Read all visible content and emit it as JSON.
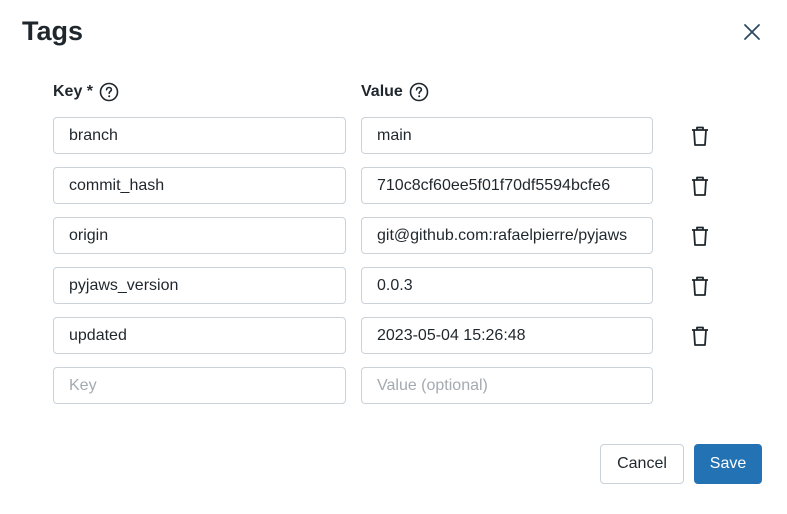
{
  "dialog": {
    "title": "Tags",
    "close_icon": "close-icon"
  },
  "columns": {
    "key_label": "Key *",
    "value_label": "Value"
  },
  "tags": [
    {
      "key": "branch",
      "value": "main"
    },
    {
      "key": "commit_hash",
      "value": "710c8cf60ee5f01f70df5594bcfe6"
    },
    {
      "key": "origin",
      "value": "git@github.com:rafaelpierre/pyjaws"
    },
    {
      "key": "pyjaws_version",
      "value": "0.0.3"
    },
    {
      "key": "updated",
      "value": "2023-05-04 15:26:48"
    }
  ],
  "new_tag": {
    "key_placeholder": "Key",
    "value_placeholder": "Value (optional)"
  },
  "buttons": {
    "cancel": "Cancel",
    "save": "Save"
  },
  "colors": {
    "primary": "#2272b4",
    "border": "#cbd2d9",
    "text": "#1f272d"
  }
}
